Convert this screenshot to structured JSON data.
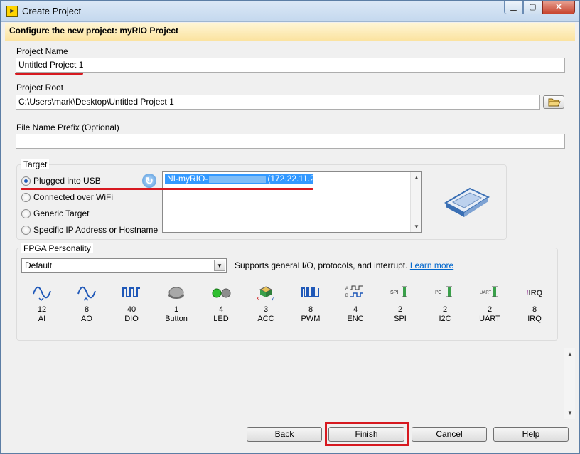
{
  "window": {
    "title": "Create Project",
    "app_icon": "labview-icon",
    "controls": [
      "minimize-icon",
      "maximize-icon",
      "close-icon"
    ]
  },
  "header": {
    "text": "Configure the new project: myRIO Project"
  },
  "project_name": {
    "label": "Project Name",
    "value": "Untitled Project 1"
  },
  "project_root": {
    "label": "Project Root",
    "value": "C:\\Users\\mark\\Desktop\\Untitled Project 1",
    "browse_icon": "folder-open-icon"
  },
  "file_prefix": {
    "label": "File Name Prefix (Optional)",
    "value": ""
  },
  "target": {
    "label": "Target",
    "options": [
      "Plugged into USB",
      "Connected over WiFi",
      "Generic Target",
      "Specific IP Address or Hostname"
    ],
    "selected": "Plugged into USB",
    "device_name": "NI-myRIO-",
    "device_ip": "(172.22.11.2)",
    "refresh_icon": "refresh-icon",
    "device_icon": "myrio-device-icon"
  },
  "fpga": {
    "label": "FPGA Personality",
    "selected": "Default",
    "description": "Supports general I/O, protocols, and interrupt.",
    "learn_more": "Learn more",
    "features": [
      {
        "count": "12",
        "name": "AI",
        "icon": "analog-in-icon"
      },
      {
        "count": "8",
        "name": "AO",
        "icon": "analog-out-icon"
      },
      {
        "count": "40",
        "name": "DIO",
        "icon": "digital-io-icon"
      },
      {
        "count": "1",
        "name": "Button",
        "icon": "button-icon"
      },
      {
        "count": "4",
        "name": "LED",
        "icon": "led-icon"
      },
      {
        "count": "3",
        "name": "ACC",
        "icon": "accelerometer-icon"
      },
      {
        "count": "8",
        "name": "PWM",
        "icon": "pwm-icon"
      },
      {
        "count": "4",
        "name": "ENC",
        "icon": "encoder-icon"
      },
      {
        "count": "2",
        "name": "SPI",
        "icon": "spi-icon"
      },
      {
        "count": "2",
        "name": "I2C",
        "icon": "i2c-icon"
      },
      {
        "count": "2",
        "name": "UART",
        "icon": "uart-icon"
      },
      {
        "count": "8",
        "name": "IRQ",
        "icon": "irq-icon"
      }
    ]
  },
  "buttons": {
    "back": "Back",
    "finish": "Finish",
    "cancel": "Cancel",
    "help": "Help"
  },
  "colors": {
    "annotation_red": "#d71920",
    "selection_blue": "#3399ff",
    "header_bg": "#fbe3a0"
  }
}
